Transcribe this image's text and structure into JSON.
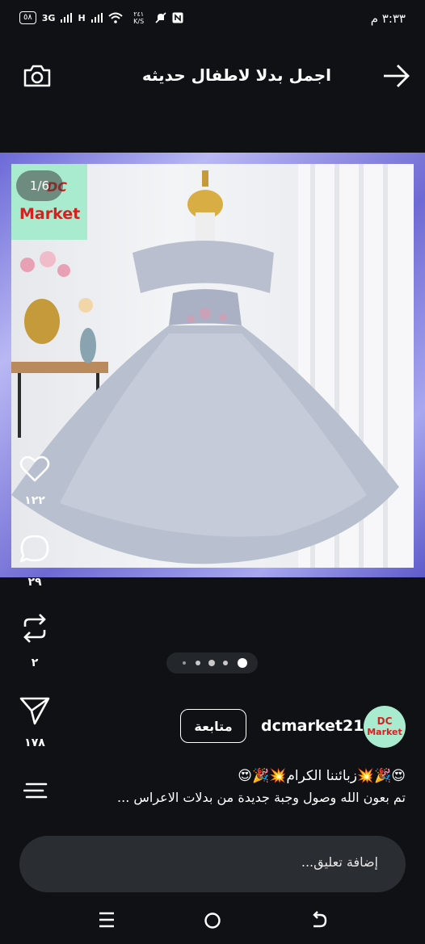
{
  "status": {
    "time": "٣:٣٣ م",
    "battery": "٥٨",
    "net1": "3G",
    "net2": "H",
    "speed": "٢٤١ K/S"
  },
  "header": {
    "title": "اجمل بدلا لاطفال حديثه"
  },
  "image": {
    "counter": "1/6",
    "logo_dc": "DC",
    "logo_market": "Market"
  },
  "actions": {
    "likes": "١٢٢",
    "comments": "٢٩",
    "reposts": "٢",
    "shares": "١٧٨"
  },
  "account": {
    "avatar_dc": "DC",
    "avatar_market": "Market",
    "username": "dcmarket21",
    "follow_label": "متابعة"
  },
  "caption": {
    "line1": "😍🎉💥زبائننا الكرام💥🎉😍",
    "line2": "تم بعون الله وصول وجبة جديدة من بدلات الاعراس ..."
  },
  "comment": {
    "placeholder": "إضافة تعليق..."
  },
  "colors": {
    "background": "#0f1114",
    "logo_bg": "#a8ebcf",
    "logo_text": "#d81f1f",
    "frame": "#7c7ae0"
  }
}
